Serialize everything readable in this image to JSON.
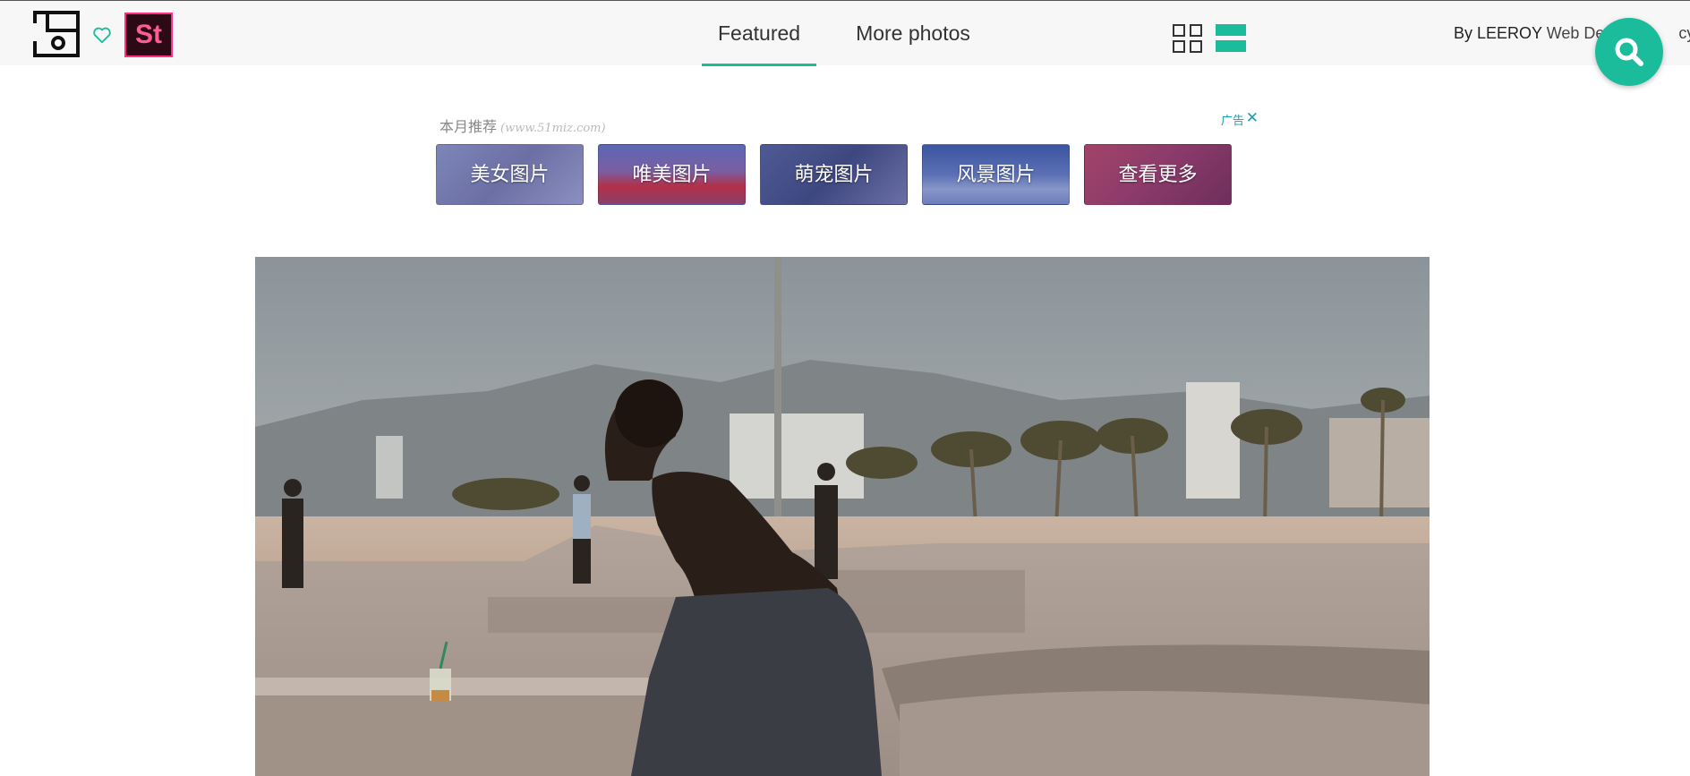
{
  "header": {
    "nav": [
      {
        "label": "Featured",
        "active": true
      },
      {
        "label": "More photos",
        "active": false
      }
    ],
    "stock_badge": "St",
    "credit_prefix": "By ",
    "credit_brand": "LEEROY",
    "credit_rest": " Web Desi",
    "credit_tail": "cy",
    "accent_color": "#1abc9c",
    "icons": [
      "logo-icon",
      "heart-icon",
      "grid-view-icon",
      "list-view-icon",
      "search-icon"
    ]
  },
  "ad": {
    "title": "本月推荐",
    "url": "(www.51miz.com)",
    "label": "广告",
    "close_glyph": "✕",
    "tiles": [
      {
        "label": "美女图片"
      },
      {
        "label": "唯美图片"
      },
      {
        "label": "萌宠图片"
      },
      {
        "label": "风景图片"
      },
      {
        "label": "查看更多"
      }
    ]
  },
  "photo": {
    "description_icon": "skatepark-photo"
  }
}
